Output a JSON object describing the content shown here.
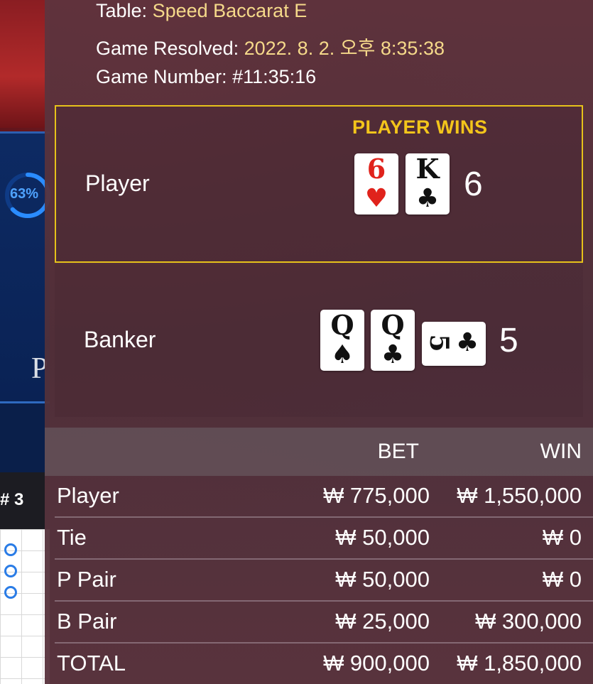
{
  "game_info": {
    "table_label": "Table:",
    "table_value": "Speed Baccarat E",
    "resolved_label": "Game Resolved:",
    "resolved_value": "2022. 8. 2. 오후 8:35:38",
    "number_label": "Game Number:",
    "number_value": "#11:35:16"
  },
  "result": {
    "winner_text": "PLAYER WINS",
    "player": {
      "label": "Player",
      "score": "6",
      "cards": [
        {
          "rank": "6",
          "suit": "♥",
          "color": "red"
        },
        {
          "rank": "K",
          "suit": "♣",
          "color": "black"
        }
      ]
    },
    "banker": {
      "label": "Banker",
      "score": "5",
      "cards": [
        {
          "rank": "Q",
          "suit": "♠",
          "color": "black"
        },
        {
          "rank": "Q",
          "suit": "♣",
          "color": "black"
        },
        {
          "rank": "5",
          "suit": "♣",
          "color": "black",
          "orientation": "sideways"
        }
      ]
    }
  },
  "bets_table": {
    "col_bet": "BET",
    "col_win": "WIN",
    "rows": [
      {
        "label": "Player",
        "bet": "₩ 775,000",
        "win": "₩ 1,550,000"
      },
      {
        "label": "Tie",
        "bet": "₩ 50,000",
        "win": "₩ 0"
      },
      {
        "label": "P Pair",
        "bet": "₩ 50,000",
        "win": "₩ 0"
      },
      {
        "label": "B Pair",
        "bet": "₩ 25,000",
        "win": "₩ 300,000"
      },
      {
        "label": "TOTAL",
        "bet": "₩ 900,000",
        "win": "₩ 1,850,000"
      }
    ]
  },
  "background": {
    "progress_label": "63%",
    "progress_value": 0.63,
    "player_word": "P",
    "round_label": "# 3"
  },
  "colors": {
    "accent_gold": "#f3c51b",
    "value_gold": "#f5d98a",
    "card_red": "#e0231c",
    "progress_blue": "#2a8cff"
  }
}
